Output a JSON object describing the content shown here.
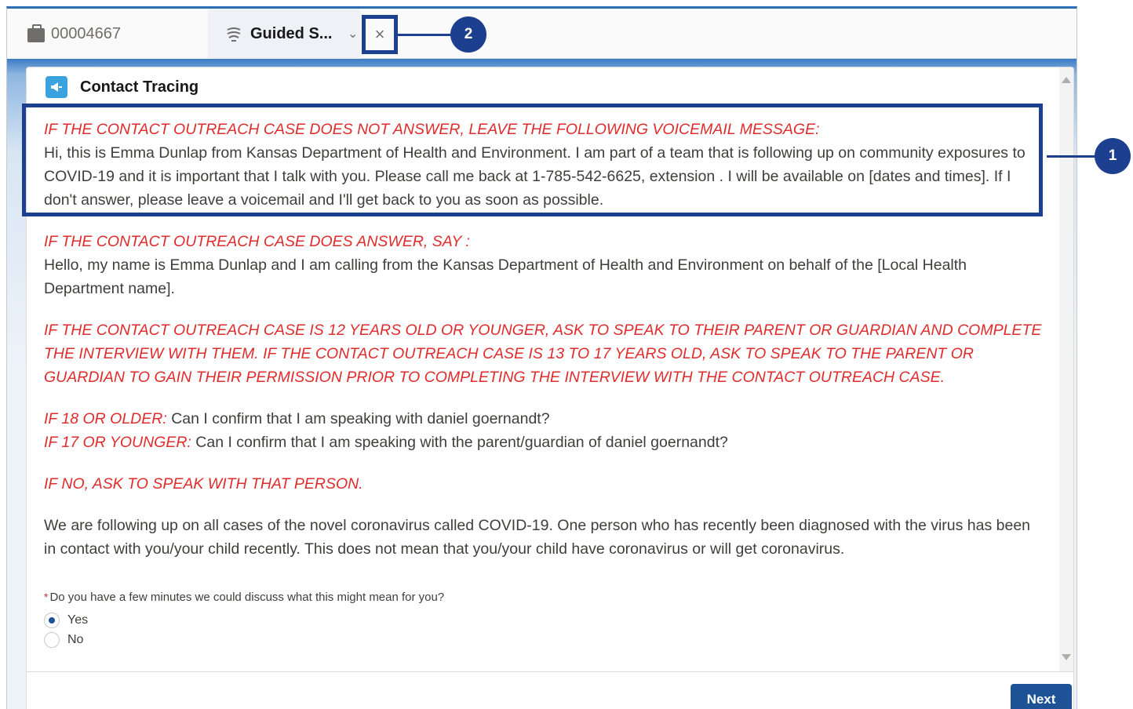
{
  "tabs": {
    "case_label": "00004667",
    "guided_label": "Guided S...",
    "close_symbol": "×",
    "chevron_symbol": "⌄"
  },
  "card": {
    "title": "Contact Tracing",
    "icon": "megaphone-icon"
  },
  "script": {
    "voicemail_heading": "IF THE CONTACT OUTREACH CASE DOES NOT ANSWER, LEAVE THE FOLLOWING VOICEMAIL MESSAGE:",
    "voicemail_text": "Hi, this is Emma Dunlap from Kansas Department of Health and Environment. I am part of a team that is following up on community exposures to COVID-19 and it is important that I talk with you. Please call me back at 1-785-542-6625, extension . I will be available on [dates and times]. If I don't answer, please leave a voicemail and I'll get back to you as soon as possible.",
    "answer_heading": "IF THE CONTACT OUTREACH CASE DOES ANSWER, SAY :",
    "answer_text": "Hello, my name is Emma Dunlap and I am calling from the Kansas Department of Health and Environment on behalf of the [Local Health Department name].",
    "age_instruction": "IF THE CONTACT OUTREACH CASE IS 12 YEARS OLD OR YOUNGER, ASK TO SPEAK TO THEIR PARENT OR GUARDIAN AND COMPLETE THE INTERVIEW WITH THEM. IF THE CONTACT OUTREACH CASE IS 13 TO 17 YEARS OLD, ASK TO SPEAK TO THE PARENT OR GUARDIAN TO GAIN THEIR PERMISSION PRIOR TO COMPLETING THE INTERVIEW WITH THE CONTACT OUTREACH CASE.",
    "older_label": "IF 18 OR OLDER:",
    "older_text": "Can I confirm that I am speaking with daniel goernandt?",
    "younger_label": "IF 17 OR YOUNGER:",
    "younger_text": "Can I confirm that I am speaking with the parent/guardian of daniel goernandt?",
    "no_instruction": "IF NO, ASK TO SPEAK WITH THAT PERSON.",
    "intro_text": "We are following up on all cases of the novel coronavirus called COVID-19. One person who has recently been diagnosed with the virus has been in contact with you/your child recently. This does not mean that you/your child have coronavirus or will get coronavirus."
  },
  "question": {
    "required_mark": "*",
    "label": "Do you have a few minutes we could discuss what this might mean for you?",
    "options": [
      {
        "label": "Yes",
        "selected": true
      },
      {
        "label": "No",
        "selected": false
      }
    ]
  },
  "footer": {
    "next_label": "Next"
  },
  "callouts": {
    "one": "1",
    "two": "2"
  },
  "colors": {
    "accent": "#1d3f8f",
    "instruction_red": "#e02c2c",
    "button_blue": "#1d5396"
  }
}
